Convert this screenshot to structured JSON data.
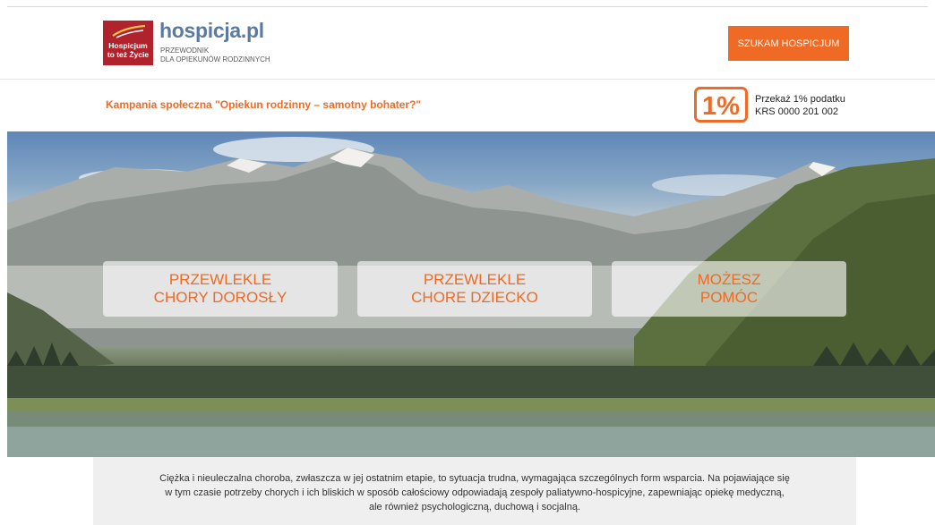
{
  "header": {
    "logo_line1": "Hospicjum",
    "logo_line2": "to też Życie",
    "brand": "hospicja.pl",
    "brand_sub1": "PRZEWODNIK",
    "brand_sub2": "DLA OPIEKUNÓW RODZINNYCH",
    "cta_label": "SZUKAM HOSPICJUM"
  },
  "campaign": {
    "title": "Kampania społeczna \"Opiekun rodzinny – samotny bohater?\"",
    "tax_icon_text": "1%",
    "tax_line1": "Przekaż 1% podatku",
    "tax_line2": "KRS 0000 201 002"
  },
  "tiles": [
    {
      "line1": "PRZEWLEKLE",
      "line2": "CHORY DOROSŁY"
    },
    {
      "line1": "PRZEWLEKLE",
      "line2": "CHORE DZIECKO"
    },
    {
      "line1": "MOŻESZ",
      "line2": "POMÓC"
    }
  ],
  "intro": {
    "line1": "Ciężka i nieuleczalna choroba, zwłaszcza w jej ostatnim etapie, to sytuacja trudna, wymagająca szczególnych form wsparcia. Na pojawiające się",
    "line2": "w tym czasie potrzeby chorych i ich bliskich w sposób całościowy odpowiadają zespoły paliatywno-hospicyjne, zapewniając opiekę medyczną,",
    "line3": "ale również psychologiczną, duchową i socjalną."
  },
  "colors": {
    "accent": "#ee6a25",
    "logo_red": "#b1232c",
    "brand_blue": "#5a7aa0"
  }
}
